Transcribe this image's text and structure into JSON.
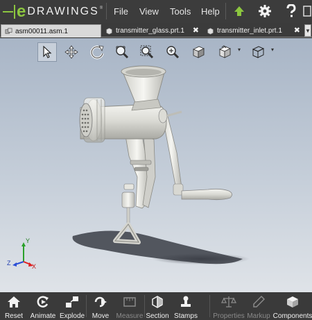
{
  "app": {
    "logo_e": "e",
    "logo_word": "DRAWINGS",
    "logo_reg": "®"
  },
  "menu": {
    "file": "File",
    "view": "View",
    "tools": "Tools",
    "help": "Help"
  },
  "tabs": [
    {
      "label": "asm00011.asm.1",
      "active": true
    },
    {
      "label": "transmitter_glass.prt.1",
      "active": false
    },
    {
      "label": "transmitter_inlet.prt.1",
      "active": false
    }
  ],
  "tab_close": "✖",
  "tab_overflow": "▼",
  "caret": "▾",
  "axes": {
    "x": "X",
    "y": "Y",
    "z": "Z"
  },
  "bottom_tools": {
    "reset": "Reset",
    "animate": "Animate",
    "explode": "Explode",
    "move": "Move",
    "measure": "Measure",
    "section": "Section",
    "stamps": "Stamps",
    "properties": "Properties",
    "markup": "Markup",
    "components": "Components"
  },
  "colors": {
    "accent_green": "#8cc63f",
    "titlebar": "#3c3c3c",
    "viewport_top": "#a8b5c6"
  }
}
